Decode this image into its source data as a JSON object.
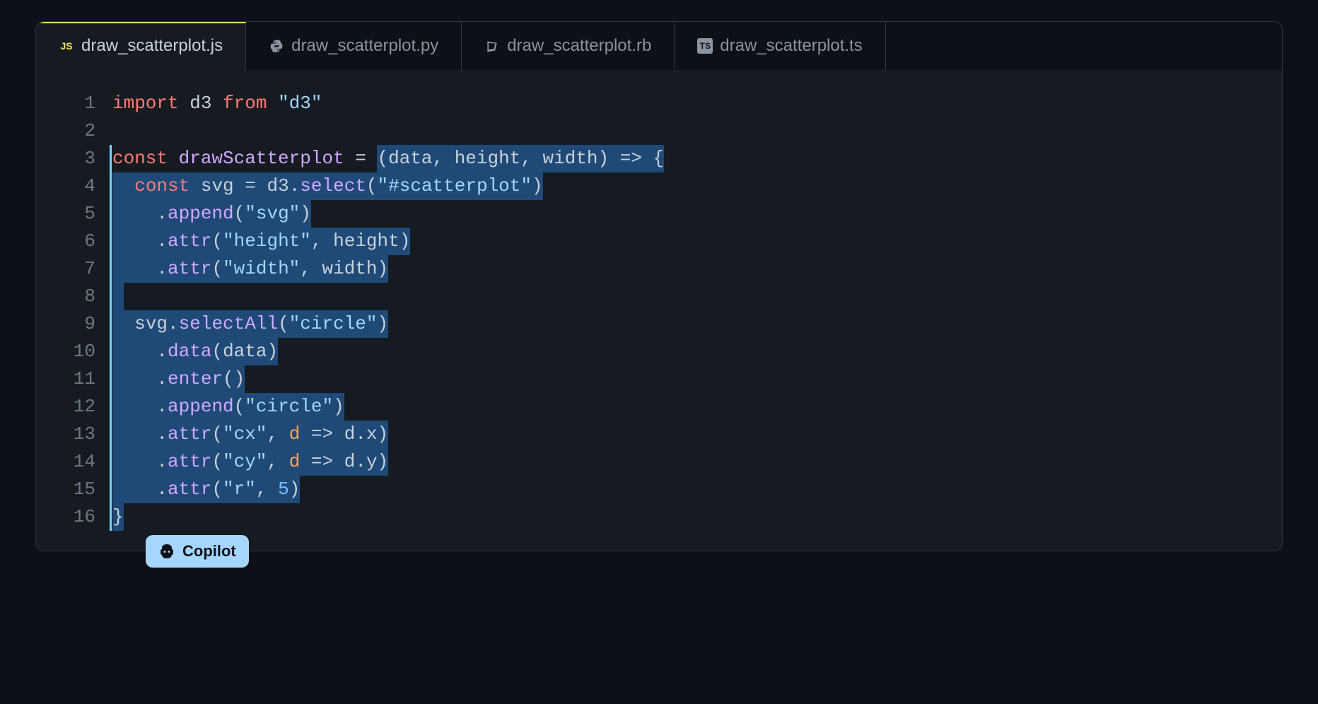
{
  "tabs": [
    {
      "icon": "js",
      "label": "draw_scatterplot.js",
      "active": true
    },
    {
      "icon": "python",
      "label": "draw_scatterplot.py",
      "active": false
    },
    {
      "icon": "ruby",
      "label": "draw_scatterplot.rb",
      "active": false
    },
    {
      "icon": "ts",
      "label": "draw_scatterplot.ts",
      "active": false
    }
  ],
  "lineNumbers": [
    "1",
    "2",
    "3",
    "4",
    "5",
    "6",
    "7",
    "8",
    "9",
    "10",
    "11",
    "12",
    "13",
    "14",
    "15",
    "16"
  ],
  "code": {
    "l1": {
      "import": "import",
      "d3": "d3",
      "from": "from",
      "str": "\"d3\""
    },
    "l3": {
      "const": "const",
      "name": "drawScatterplot",
      "eq": " = ",
      "params": "(data, height, width)",
      "arrow": " => {"
    },
    "l4": {
      "const": "const",
      "svg": "svg",
      "eq": " = ",
      "d3": "d3",
      "dot": ".",
      "select": "select",
      "open": "(",
      "str": "\"#scatterplot\"",
      "close": ")"
    },
    "l5": {
      "dot": ".",
      "append": "append",
      "open": "(",
      "str": "\"svg\"",
      "close": ")"
    },
    "l6": {
      "dot": ".",
      "attr": "attr",
      "open": "(",
      "str": "\"height\"",
      "comma": ", ",
      "arg": "height",
      "close": ")"
    },
    "l7": {
      "dot": ".",
      "attr": "attr",
      "open": "(",
      "str": "\"width\"",
      "comma": ", ",
      "arg": "width",
      "close": ")"
    },
    "l9": {
      "svg": "svg",
      "dot": ".",
      "selectAll": "selectAll",
      "open": "(",
      "str": "\"circle\"",
      "close": ")"
    },
    "l10": {
      "dot": ".",
      "data": "data",
      "open": "(",
      "arg": "data",
      "close": ")"
    },
    "l11": {
      "dot": ".",
      "enter": "enter",
      "open": "(",
      "close": ")"
    },
    "l12": {
      "dot": ".",
      "append": "append",
      "open": "(",
      "str": "\"circle\"",
      "close": ")"
    },
    "l13": {
      "dot": ".",
      "attr": "attr",
      "open": "(",
      "str": "\"cx\"",
      "comma": ", ",
      "d": "d",
      "arrow": " => ",
      "dx": "d.x",
      "close": ")"
    },
    "l14": {
      "dot": ".",
      "attr": "attr",
      "open": "(",
      "str": "\"cy\"",
      "comma": ", ",
      "d": "d",
      "arrow": " => ",
      "dy": "d.y",
      "close": ")"
    },
    "l15": {
      "dot": ".",
      "attr": "attr",
      "open": "(",
      "str": "\"r\"",
      "comma": ", ",
      "num": "5",
      "close": ")"
    },
    "l16": {
      "brace": "}"
    }
  },
  "copilot": {
    "label": "Copilot"
  }
}
